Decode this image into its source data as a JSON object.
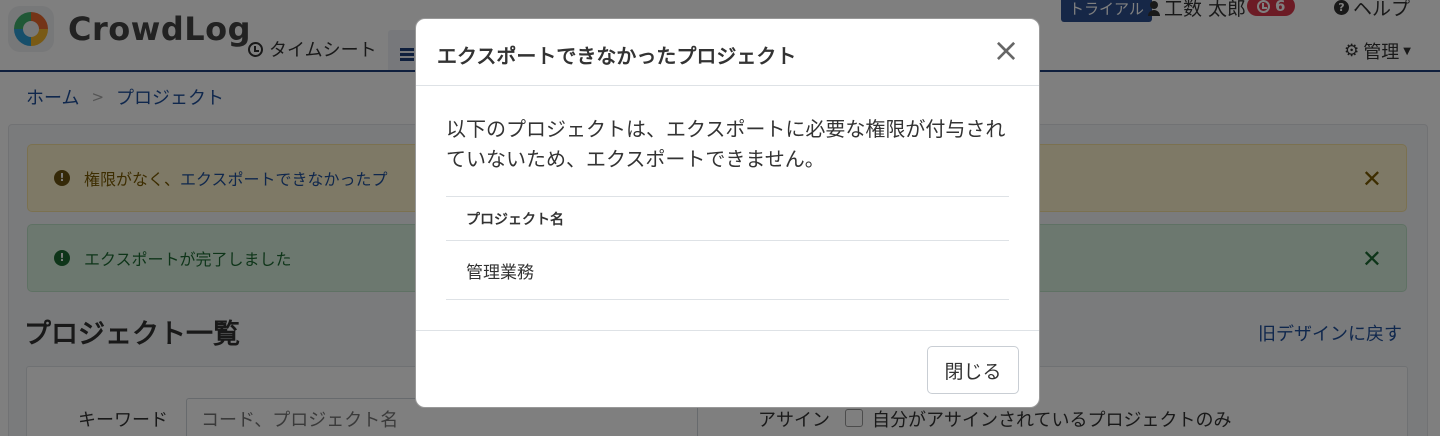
{
  "app": {
    "logo_text": "CrowdLog"
  },
  "nav": {
    "timesheet": "タイムシート",
    "trial_badge": "トライアル",
    "user_name": "工数 太郎",
    "notification_count": "6",
    "help": "ヘルプ",
    "admin": "管理"
  },
  "breadcrumb": {
    "home": "ホーム",
    "current": "プロジェクト"
  },
  "alerts": {
    "warning_prefix": "権限がなく、",
    "warning_link": "エクスポートできなかったプ",
    "success": "エクスポートが完了しました"
  },
  "page": {
    "title": "プロジェクト一覧",
    "old_design_link": "旧デザインに戻す"
  },
  "filters": {
    "keyword_label": "キーワード",
    "keyword_placeholder": "コード、プロジェクト名",
    "assign_label": "アサイン",
    "assign_option": "自分がアサインされているプロジェクトのみ"
  },
  "modal": {
    "title": "エクスポートできなかったプロジェクト",
    "message": "以下のプロジェクトは、エクスポートに必要な権限が付与されていないため、エクスポートできません。",
    "table_header": "プロジェクト名",
    "rows": [
      "管理業務"
    ],
    "close_button": "閉じる"
  },
  "colors": {
    "brand_navy": "#1f3f7a",
    "link_blue": "#1f4f9a",
    "badge_red": "#d9374a",
    "warning_bg": "#fdf2cc",
    "success_bg": "#d9f0df"
  }
}
